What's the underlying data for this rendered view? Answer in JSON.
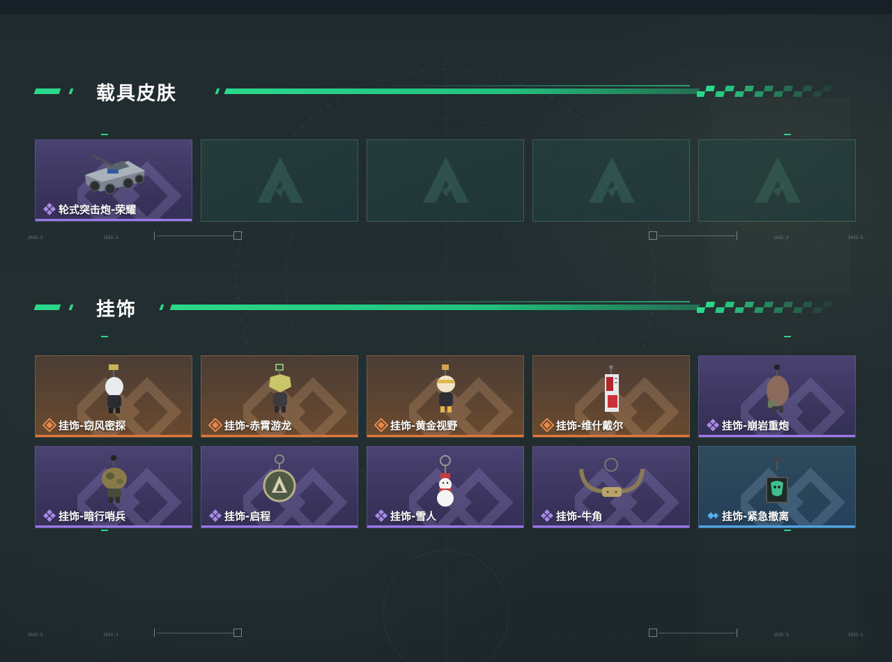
{
  "sections": {
    "vehicle": {
      "title": "载具皮肤",
      "items": [
        {
          "label": "轮式突击炮-荣耀",
          "rarity": "purple",
          "icon": "armored-vehicle"
        }
      ],
      "empty_slots": 4
    },
    "charms": {
      "title": "挂饰",
      "items": [
        {
          "label": "挂饰-窃风密探",
          "rarity": "orange",
          "icon": "charm-white-figure"
        },
        {
          "label": "挂饰-赤霄游龙",
          "rarity": "orange",
          "icon": "charm-dragon-figure"
        },
        {
          "label": "挂饰-黄金视野",
          "rarity": "orange",
          "icon": "charm-gold-figure"
        },
        {
          "label": "挂饰-维什戴尔",
          "rarity": "orange",
          "icon": "charm-card-tag"
        },
        {
          "label": "挂饰-崩岩重炮",
          "rarity": "purple",
          "icon": "charm-rock-figure"
        },
        {
          "label": "挂饰-暗行哨兵",
          "rarity": "purple",
          "icon": "charm-camo-figure"
        },
        {
          "label": "挂饰-启程",
          "rarity": "purple",
          "icon": "charm-medallion"
        },
        {
          "label": "挂饰-雪人",
          "rarity": "purple",
          "icon": "charm-snowman"
        },
        {
          "label": "挂饰-牛角",
          "rarity": "purple",
          "icon": "charm-horns"
        },
        {
          "label": "挂饰-紧急撤离",
          "rarity": "blue",
          "icon": "charm-green-tag"
        }
      ]
    }
  },
  "rarity_colors": {
    "purple": "#9a78e6",
    "orange": "#e0773a",
    "blue": "#4ea4e6"
  },
  "accent_color": "#2bd88a",
  "watermark_marks": [
    "2035-5",
    "0",
    "1935-3",
    "0"
  ]
}
